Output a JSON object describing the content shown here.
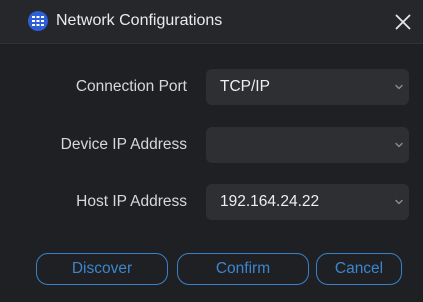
{
  "window": {
    "title": "Network Configurations"
  },
  "form": {
    "connection_port": {
      "label": "Connection Port",
      "value": "TCP/IP"
    },
    "device_ip": {
      "label": "Device IP Address",
      "value": ""
    },
    "host_ip": {
      "label": "Host IP Address",
      "value": "192.164.24.22"
    }
  },
  "buttons": {
    "discover": "Discover",
    "confirm": "Confirm",
    "cancel": "Cancel"
  },
  "icons": {
    "app": "network-app-icon",
    "close": "close-icon",
    "dropdown": "chevron-down-icon"
  },
  "colors": {
    "accent": "#3a82c8",
    "app_icon": "#2d5fd6",
    "background": "#1e2023"
  }
}
